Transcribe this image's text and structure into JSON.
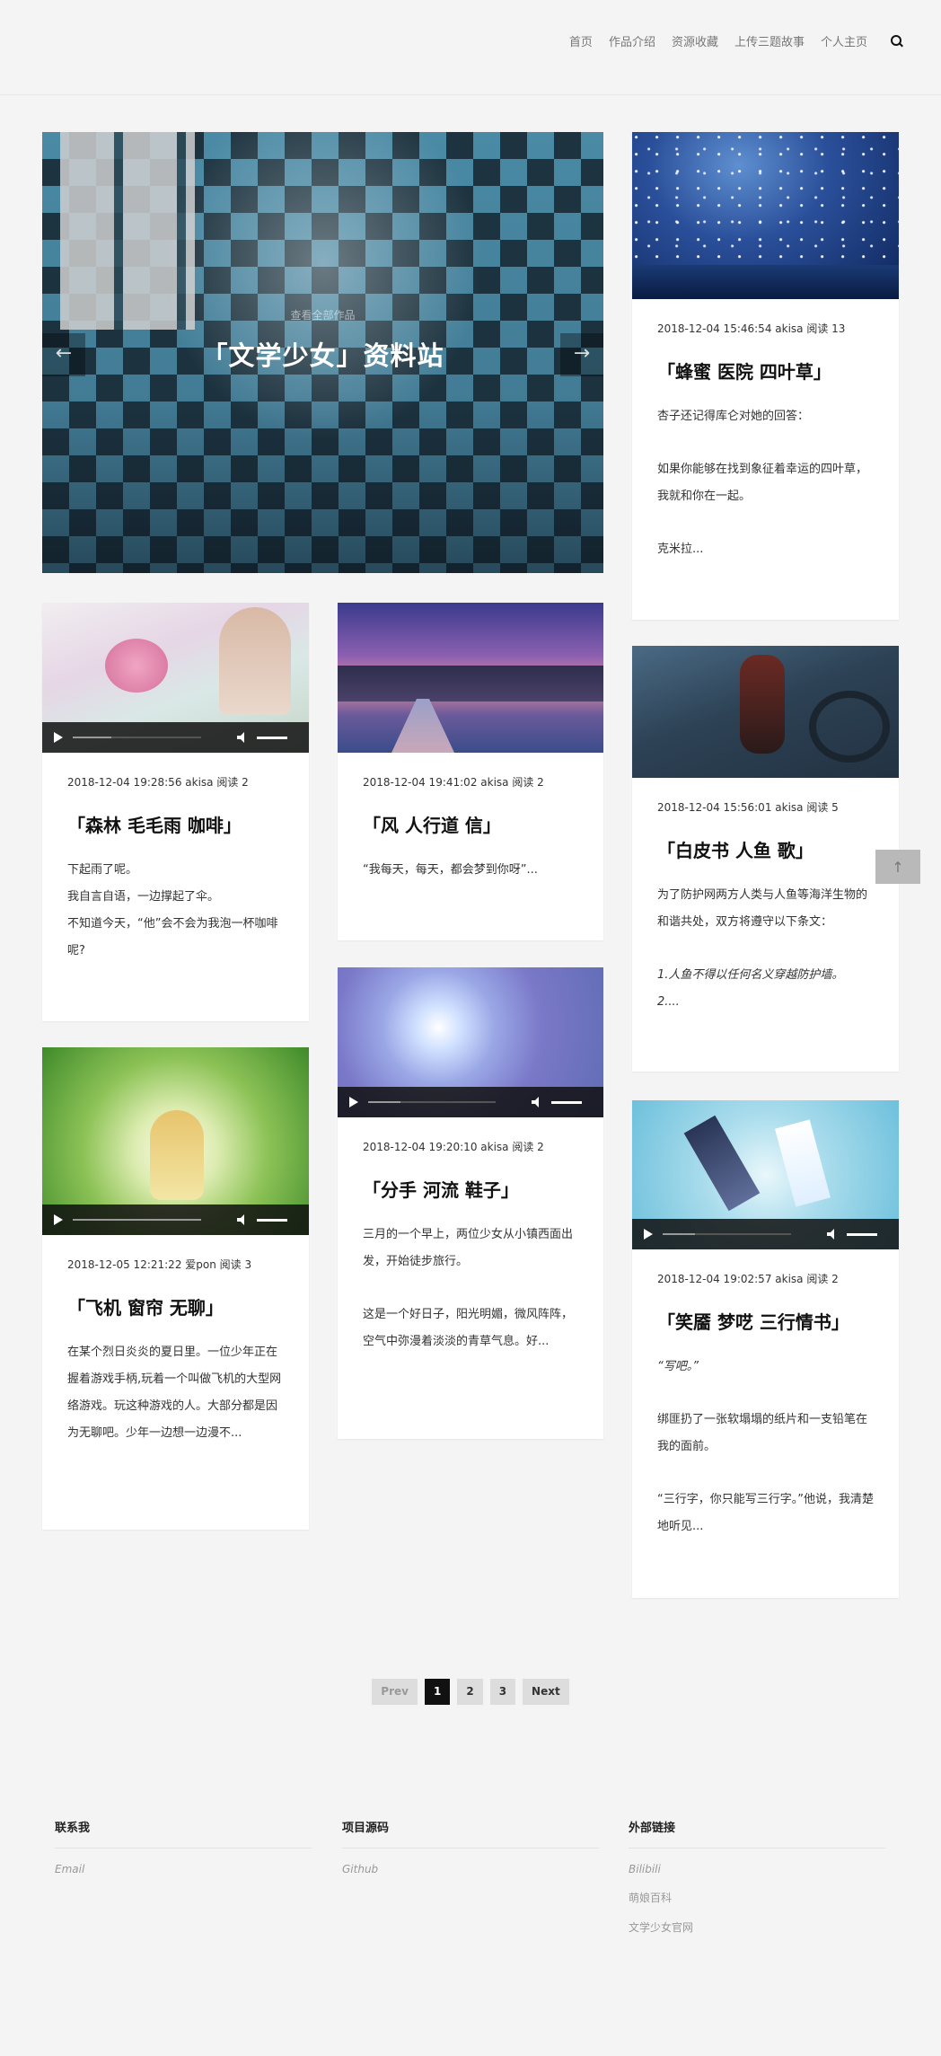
{
  "nav": {
    "items": [
      "首页",
      "作品介绍",
      "资源收藏",
      "上传三题故事",
      "个人主页"
    ],
    "search_icon": "search-icon"
  },
  "slider": {
    "subtitle": "查看全部作品",
    "title": "「文学少女」资料站",
    "prev_icon": "arrow-left-icon",
    "next_icon": "arrow-right-icon",
    "prev_glyph": "←",
    "next_glyph": "→"
  },
  "posts": [
    {
      "meta": "2018-12-04 15:46:54 akisa  阅读 13",
      "title": "「蜂蜜 医院 四叶草」",
      "paragraphs": [
        "杏子还记得库仑对她的回答：",
        "如果你能够在找到象征着幸运的四叶草，我就和你在一起。",
        "克米拉..."
      ]
    },
    {
      "meta": "2018-12-04 19:28:56 akisa  阅读 2",
      "title": "「森林 毛毛雨 咖啡」",
      "paragraphs": [
        "下起雨了呢。",
        "我自言自语，一边撑起了伞。",
        "不知道今天，“他”会不会为我泡一杯咖啡呢?"
      ]
    },
    {
      "meta": "2018-12-04 19:41:02 akisa  阅读 2",
      "title": "「风 人行道 信」",
      "paragraphs": [
        "“我每天，每天，都会梦到你呀”..."
      ]
    },
    {
      "meta": "2018-12-04 15:56:01 akisa  阅读 5",
      "title": "「白皮书 人鱼 歌」",
      "paragraphs": [
        "为了防护网两方人类与人鱼等海洋生物的和谐共处，双方将遵守以下条文：",
        "1.人鱼不得以任何名义穿越防护墙。",
        "2...."
      ]
    },
    {
      "meta": "2018-12-04 19:20:10 akisa  阅读 2",
      "title": "「分手 河流 鞋子」",
      "paragraphs": [
        "三月的一个早上，两位少女从小镇西面出发，开始徒步旅行。",
        "这是一个好日子，阳光明媚，微风阵阵，空气中弥漫着淡淡的青草气息。好..."
      ]
    },
    {
      "meta": "2018-12-05 12:21:22 爱pon  阅读 3",
      "title": "「飞机 窗帘 无聊」",
      "paragraphs": [
        "在某个烈日炎炎的夏日里。一位少年正在握着游戏手柄,玩着一个叫做飞机的大型网络游戏。玩这种游戏的人。大部分都是因为无聊吧。少年一边想一边漫不..."
      ]
    },
    {
      "meta": "2018-12-04 19:02:57 akisa  阅读 2",
      "title": "「笑靥 梦呓 三行情书」",
      "paragraphs": [
        "“写吧。”",
        "绑匪扔了一张软塌塌的纸片和一支铅笔在我的面前。",
        "“三行字，你只能写三行字。”他说，我清楚地听见..."
      ]
    }
  ],
  "pager": {
    "prev": "Prev",
    "pages": [
      "1",
      "2",
      "3"
    ],
    "next": "Next",
    "current": "1"
  },
  "footer": {
    "contact": {
      "title": "联系我",
      "links": [
        "Email"
      ]
    },
    "source": {
      "title": "项目源码",
      "links": [
        "Github"
      ]
    },
    "external": {
      "title": "外部链接",
      "links": [
        "Bilibili",
        "萌娘百科",
        "文学少女官网"
      ]
    }
  },
  "to_top": {
    "icon": "arrow-up-icon",
    "glyph": "↑"
  },
  "colors": {
    "background": "#f4f4f4",
    "card": "#ffffff",
    "pager_active": "#111111",
    "pager_inactive": "#dddddd"
  }
}
